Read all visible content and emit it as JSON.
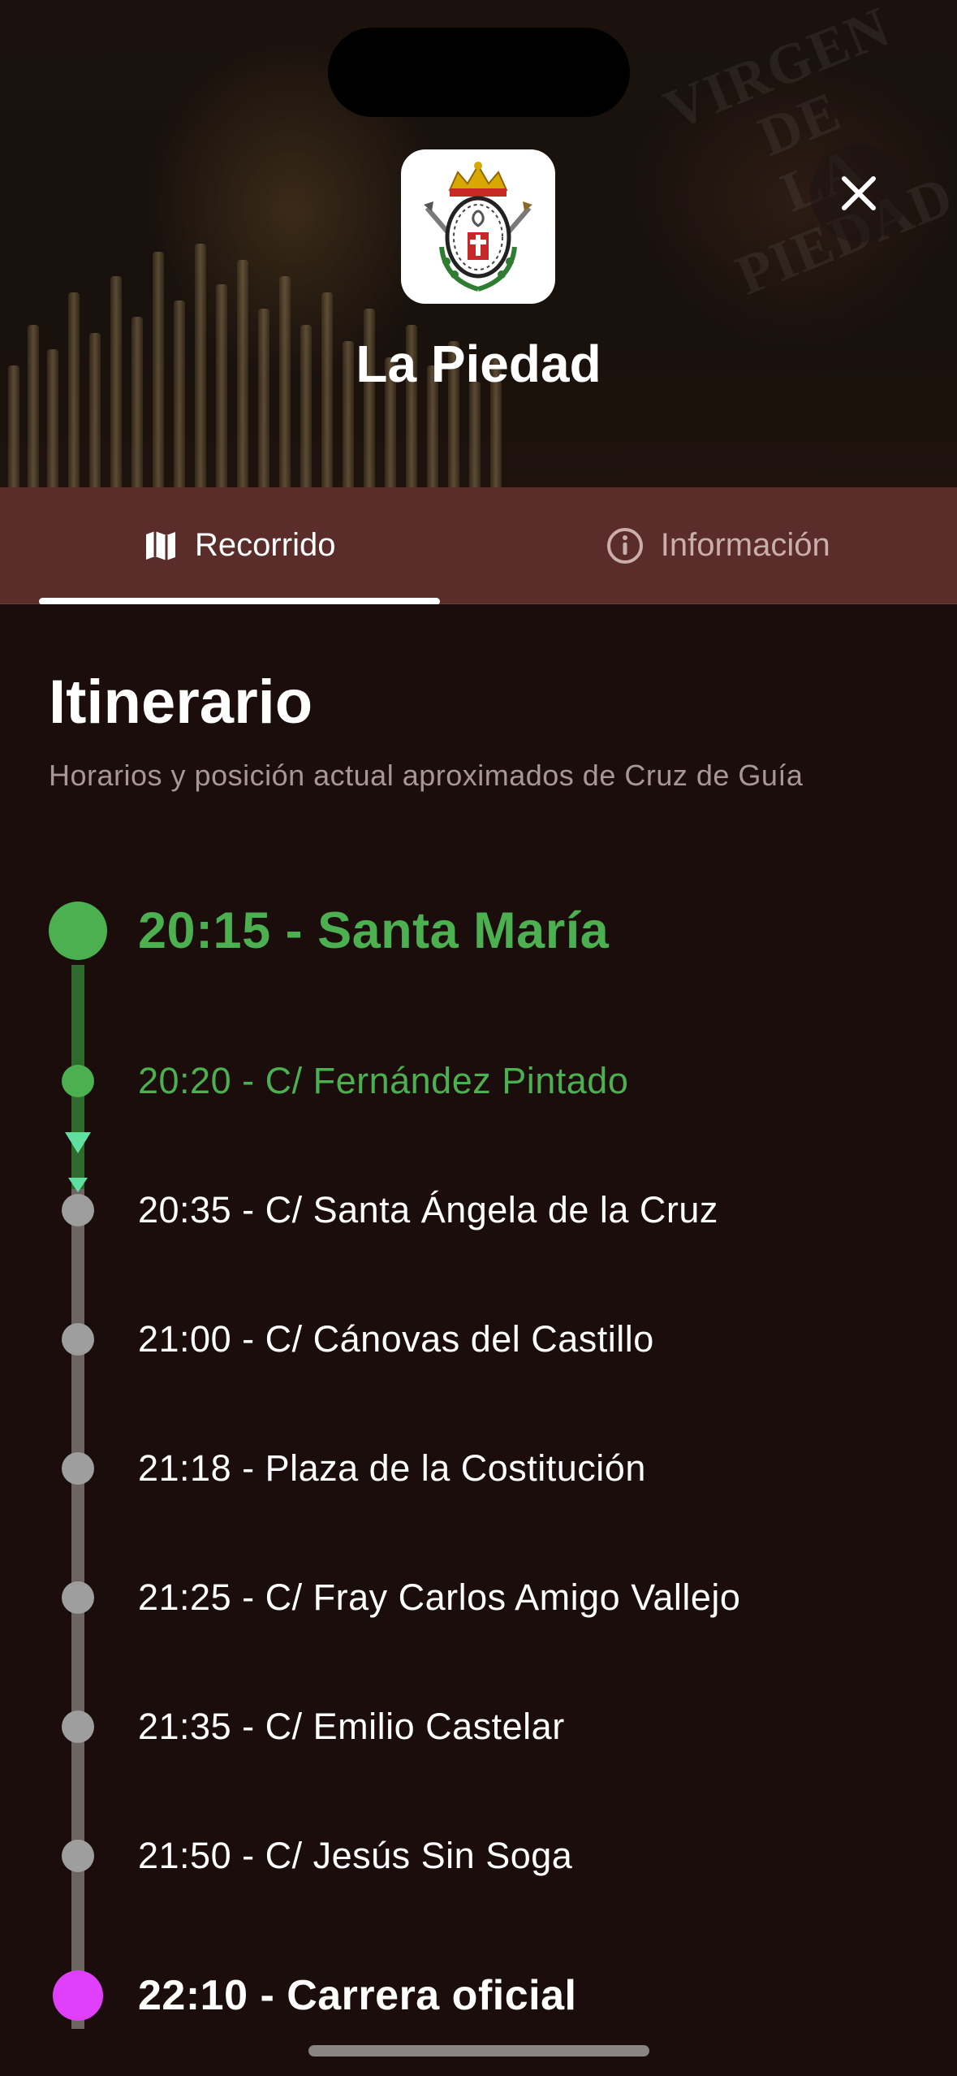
{
  "hero": {
    "brotherhood_name": "La Piedad",
    "background_text": "VIRGEN DE LA PIEDAD"
  },
  "tabs": [
    {
      "label": "Recorrido",
      "icon": "map-icon",
      "active": true
    },
    {
      "label": "Información",
      "icon": "info-icon",
      "active": false
    }
  ],
  "itinerary": {
    "title": "Itinerario",
    "subtitle": "Horarios y posición actual aproximados de Cruz de Guía",
    "stops": [
      {
        "label": "20:15 - Santa María",
        "status": "start"
      },
      {
        "label": "20:20 - C/ Fernández Pintado",
        "status": "passed"
      },
      {
        "label": "20:35 - C/ Santa Ángela de la Cruz",
        "status": "upcoming"
      },
      {
        "label": "21:00 - C/ Cánovas del Castillo",
        "status": "upcoming"
      },
      {
        "label": "21:18 - Plaza de la Costitución",
        "status": "upcoming"
      },
      {
        "label": "21:25 - C/ Fray Carlos Amigo Vallejo",
        "status": "upcoming"
      },
      {
        "label": "21:35 - C/ Emilio Castelar",
        "status": "upcoming"
      },
      {
        "label": "21:50 - C/ Jesús Sin Soga",
        "status": "upcoming"
      },
      {
        "label": "22:10 - Carrera oficial",
        "status": "milestone"
      }
    ]
  },
  "colors": {
    "accent_green": "#4caf50",
    "position_marker": "#5fe0a0",
    "milestone_magenta": "#e040fb",
    "upcoming_grey": "#9e9e9e",
    "tab_bar": "#5a2c2a",
    "background": "#1a0d0b"
  }
}
